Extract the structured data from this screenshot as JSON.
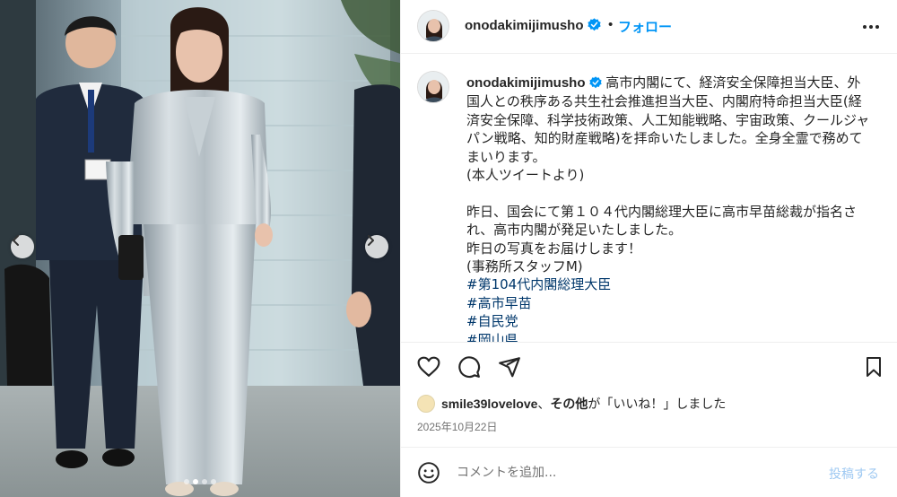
{
  "photo": {
    "alt_icon": "photo-carousel",
    "prev_icon": "chevron-left-icon",
    "next_icon": "chevron-right-icon",
    "dots_total": 4,
    "dot_active": 1
  },
  "header": {
    "username": "onodakimijimusho",
    "separator": "•",
    "follow_label": "フォロー",
    "more_icon": "more-horizontal-icon"
  },
  "caption": {
    "username": "onodakimijimusho",
    "paragraphs": [
      "高市内閣にて、経済安全保障担当大臣、外国人との秩序ある共生社会推進担当大臣、内閣府特命担当大臣(経済安全保障、科学技術政策、人工知能戦略、宇宙政策、クールジャパン戦略、知的財産戦略)を拝命いたしました。全身全霊で務めてまいります。",
      "(本人ツイートより)",
      "",
      "昨日、国会にて第１０４代内閣総理大臣に高市早苗総裁が指名され、高市内閣が発足いたしました。",
      "昨日の写真をお届けします！",
      "(事務所スタッフM)"
    ],
    "hashtags": [
      "#第104代内閣総理大臣",
      "#高市早苗",
      "#自民党",
      "#岡山県"
    ]
  },
  "actions": {
    "like_icon": "heart-icon",
    "comment_icon": "comment-icon",
    "share_icon": "send-icon",
    "save_icon": "bookmark-icon"
  },
  "likes": {
    "user": "smile39lovelove",
    "connector": "、",
    "others": "その他",
    "suffix": "が「いいね！」しました"
  },
  "date": "2025年10月22日",
  "comment": {
    "emoji_icon": "emoji-icon",
    "placeholder": "コメントを追加...",
    "post_label": "投稿する"
  },
  "colors": {
    "accent": "#0095f6",
    "hashtag": "#00376b",
    "post_disabled": "#9fc9f2",
    "muted": "#737373"
  }
}
